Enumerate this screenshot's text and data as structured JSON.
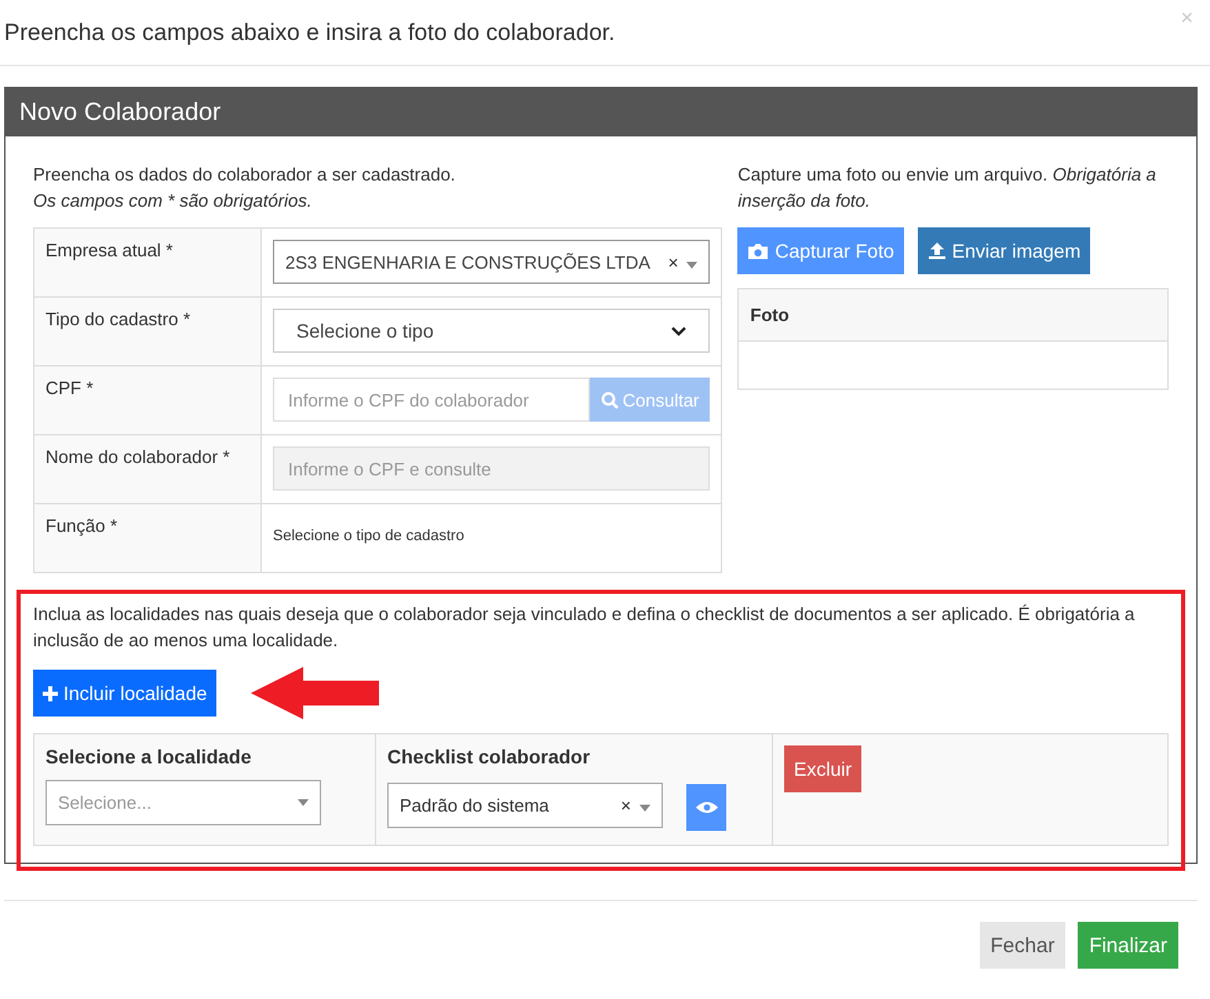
{
  "header": {
    "title": "Preencha os campos abaixo e insira a foto do colaborador.",
    "close": "×"
  },
  "panel": {
    "title": "Novo Colaborador",
    "intro": "Preencha os dados do colaborador a ser cadastrado.",
    "required_note": "Os campos com * são obrigatórios.",
    "fields": [
      {
        "label": "Empresa atual *",
        "kind": "select2",
        "value": "2S3 ENGENHARIA E CONSTRUÇÕES LTDA",
        "clear": "×"
      },
      {
        "label": "Tipo do cadastro *",
        "kind": "select",
        "value": "Selecione o tipo"
      },
      {
        "label": "CPF *",
        "kind": "search",
        "placeholder": "Informe o CPF do colaborador",
        "button": "Consultar",
        "disabled": true
      },
      {
        "label": "Nome do colaborador *",
        "kind": "input",
        "placeholder": "Informe o CPF e consulte",
        "disabled": true
      },
      {
        "label": "Função *",
        "kind": "text",
        "value": "Selecione o tipo de cadastro"
      }
    ],
    "photo": {
      "intro": "Capture uma foto ou envie um arquivo. *Obrigatória a inserção da foto.*",
      "capture_button": "Capturar Foto",
      "upload_button": "Enviar imagem",
      "table_header": "Foto"
    },
    "locations": {
      "intro": "Inclua as localidades nas quais deseja que o colaborador seja vinculado e defina o checklist de documentos a ser aplicado. É obrigatória a inclusão de ao menos uma localidade.",
      "add_button": "Incluir localidade",
      "columns": [
        "Selecione a localidade",
        "Checklist colaborador"
      ],
      "rows": [
        {
          "location_placeholder": "Selecione...",
          "checklist": "Padrão do sistema",
          "clear": "×",
          "delete_button": "Excluir"
        }
      ]
    }
  },
  "footer": {
    "buttons": [
      {
        "label": "Fechar",
        "kind": "default"
      },
      {
        "label": "Finalizar",
        "kind": "success"
      }
    ]
  }
}
